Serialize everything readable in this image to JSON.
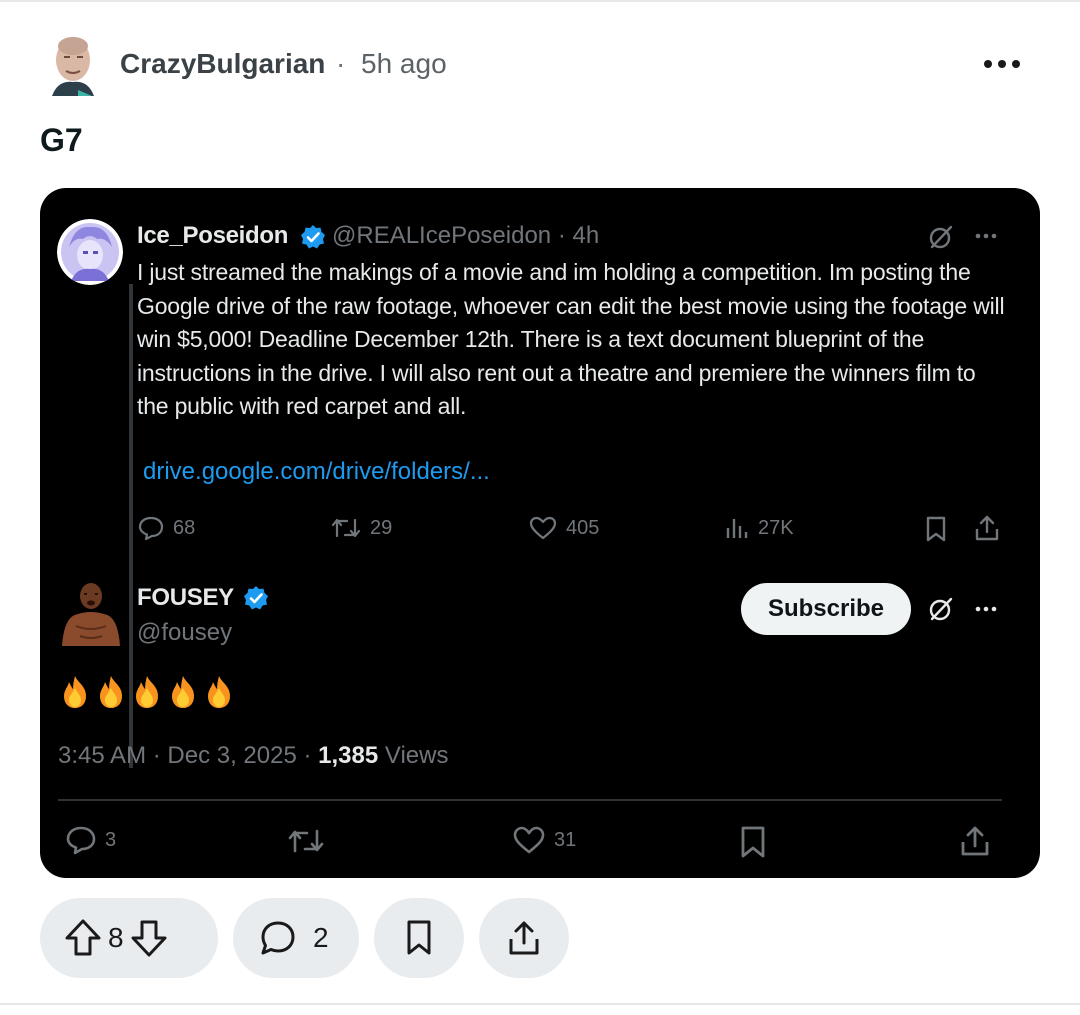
{
  "post": {
    "username": "CrazyBulgarian",
    "separator": "·",
    "time": "5h ago",
    "title": "G7"
  },
  "embed": {
    "quoted_tweet": {
      "name": "Ice_Poseidon",
      "handle_time": "@REALIcePoseidon · 4h",
      "text": "I just streamed the makings of a movie and im holding a competition. Im posting the Google drive of the raw footage, whoever can edit the best movie using the footage will win $5,000! Deadline December 12th. There is a text document blueprint of the instructions in the drive. I will also rent out a theatre and premiere the winners film to the public with red carpet and all.",
      "link": "drive.google.com/drive/folders/...",
      "replies": "68",
      "retweets": "29",
      "likes": "405",
      "views": "27K"
    },
    "reply_tweet": {
      "name": "FOUSEY",
      "handle": "@fousey",
      "subscribe_label": "Subscribe",
      "emojis": [
        "🔥",
        "🔥",
        "🔥",
        "🔥",
        "🔥"
      ],
      "meta_prefix": "3:45 AM · Dec 3, 2025 · ",
      "views_count": "1,385",
      "views_label": " Views",
      "replies": "3",
      "likes": "31"
    }
  },
  "actions": {
    "votes": "8",
    "comments": "2"
  },
  "colors": {
    "accent_blue": "#1d9bf0",
    "card_bg": "#000000",
    "pill_bg": "#e9ecee"
  }
}
